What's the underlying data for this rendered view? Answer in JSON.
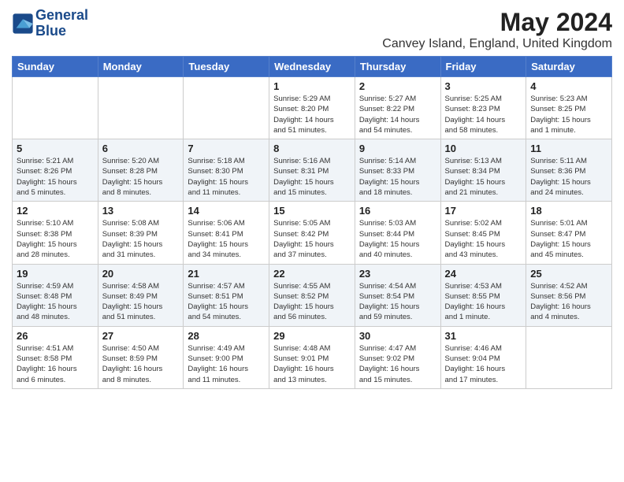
{
  "logo": {
    "line1": "General",
    "line2": "Blue"
  },
  "title": "May 2024",
  "subtitle": "Canvey Island, England, United Kingdom",
  "days_of_week": [
    "Sunday",
    "Monday",
    "Tuesday",
    "Wednesday",
    "Thursday",
    "Friday",
    "Saturday"
  ],
  "weeks": [
    [
      {
        "day": "",
        "info": ""
      },
      {
        "day": "",
        "info": ""
      },
      {
        "day": "",
        "info": ""
      },
      {
        "day": "1",
        "info": "Sunrise: 5:29 AM\nSunset: 8:20 PM\nDaylight: 14 hours\nand 51 minutes."
      },
      {
        "day": "2",
        "info": "Sunrise: 5:27 AM\nSunset: 8:22 PM\nDaylight: 14 hours\nand 54 minutes."
      },
      {
        "day": "3",
        "info": "Sunrise: 5:25 AM\nSunset: 8:23 PM\nDaylight: 14 hours\nand 58 minutes."
      },
      {
        "day": "4",
        "info": "Sunrise: 5:23 AM\nSunset: 8:25 PM\nDaylight: 15 hours\nand 1 minute."
      }
    ],
    [
      {
        "day": "5",
        "info": "Sunrise: 5:21 AM\nSunset: 8:26 PM\nDaylight: 15 hours\nand 5 minutes."
      },
      {
        "day": "6",
        "info": "Sunrise: 5:20 AM\nSunset: 8:28 PM\nDaylight: 15 hours\nand 8 minutes."
      },
      {
        "day": "7",
        "info": "Sunrise: 5:18 AM\nSunset: 8:30 PM\nDaylight: 15 hours\nand 11 minutes."
      },
      {
        "day": "8",
        "info": "Sunrise: 5:16 AM\nSunset: 8:31 PM\nDaylight: 15 hours\nand 15 minutes."
      },
      {
        "day": "9",
        "info": "Sunrise: 5:14 AM\nSunset: 8:33 PM\nDaylight: 15 hours\nand 18 minutes."
      },
      {
        "day": "10",
        "info": "Sunrise: 5:13 AM\nSunset: 8:34 PM\nDaylight: 15 hours\nand 21 minutes."
      },
      {
        "day": "11",
        "info": "Sunrise: 5:11 AM\nSunset: 8:36 PM\nDaylight: 15 hours\nand 24 minutes."
      }
    ],
    [
      {
        "day": "12",
        "info": "Sunrise: 5:10 AM\nSunset: 8:38 PM\nDaylight: 15 hours\nand 28 minutes."
      },
      {
        "day": "13",
        "info": "Sunrise: 5:08 AM\nSunset: 8:39 PM\nDaylight: 15 hours\nand 31 minutes."
      },
      {
        "day": "14",
        "info": "Sunrise: 5:06 AM\nSunset: 8:41 PM\nDaylight: 15 hours\nand 34 minutes."
      },
      {
        "day": "15",
        "info": "Sunrise: 5:05 AM\nSunset: 8:42 PM\nDaylight: 15 hours\nand 37 minutes."
      },
      {
        "day": "16",
        "info": "Sunrise: 5:03 AM\nSunset: 8:44 PM\nDaylight: 15 hours\nand 40 minutes."
      },
      {
        "day": "17",
        "info": "Sunrise: 5:02 AM\nSunset: 8:45 PM\nDaylight: 15 hours\nand 43 minutes."
      },
      {
        "day": "18",
        "info": "Sunrise: 5:01 AM\nSunset: 8:47 PM\nDaylight: 15 hours\nand 45 minutes."
      }
    ],
    [
      {
        "day": "19",
        "info": "Sunrise: 4:59 AM\nSunset: 8:48 PM\nDaylight: 15 hours\nand 48 minutes."
      },
      {
        "day": "20",
        "info": "Sunrise: 4:58 AM\nSunset: 8:49 PM\nDaylight: 15 hours\nand 51 minutes."
      },
      {
        "day": "21",
        "info": "Sunrise: 4:57 AM\nSunset: 8:51 PM\nDaylight: 15 hours\nand 54 minutes."
      },
      {
        "day": "22",
        "info": "Sunrise: 4:55 AM\nSunset: 8:52 PM\nDaylight: 15 hours\nand 56 minutes."
      },
      {
        "day": "23",
        "info": "Sunrise: 4:54 AM\nSunset: 8:54 PM\nDaylight: 15 hours\nand 59 minutes."
      },
      {
        "day": "24",
        "info": "Sunrise: 4:53 AM\nSunset: 8:55 PM\nDaylight: 16 hours\nand 1 minute."
      },
      {
        "day": "25",
        "info": "Sunrise: 4:52 AM\nSunset: 8:56 PM\nDaylight: 16 hours\nand 4 minutes."
      }
    ],
    [
      {
        "day": "26",
        "info": "Sunrise: 4:51 AM\nSunset: 8:58 PM\nDaylight: 16 hours\nand 6 minutes."
      },
      {
        "day": "27",
        "info": "Sunrise: 4:50 AM\nSunset: 8:59 PM\nDaylight: 16 hours\nand 8 minutes."
      },
      {
        "day": "28",
        "info": "Sunrise: 4:49 AM\nSunset: 9:00 PM\nDaylight: 16 hours\nand 11 minutes."
      },
      {
        "day": "29",
        "info": "Sunrise: 4:48 AM\nSunset: 9:01 PM\nDaylight: 16 hours\nand 13 minutes."
      },
      {
        "day": "30",
        "info": "Sunrise: 4:47 AM\nSunset: 9:02 PM\nDaylight: 16 hours\nand 15 minutes."
      },
      {
        "day": "31",
        "info": "Sunrise: 4:46 AM\nSunset: 9:04 PM\nDaylight: 16 hours\nand 17 minutes."
      },
      {
        "day": "",
        "info": ""
      }
    ]
  ]
}
